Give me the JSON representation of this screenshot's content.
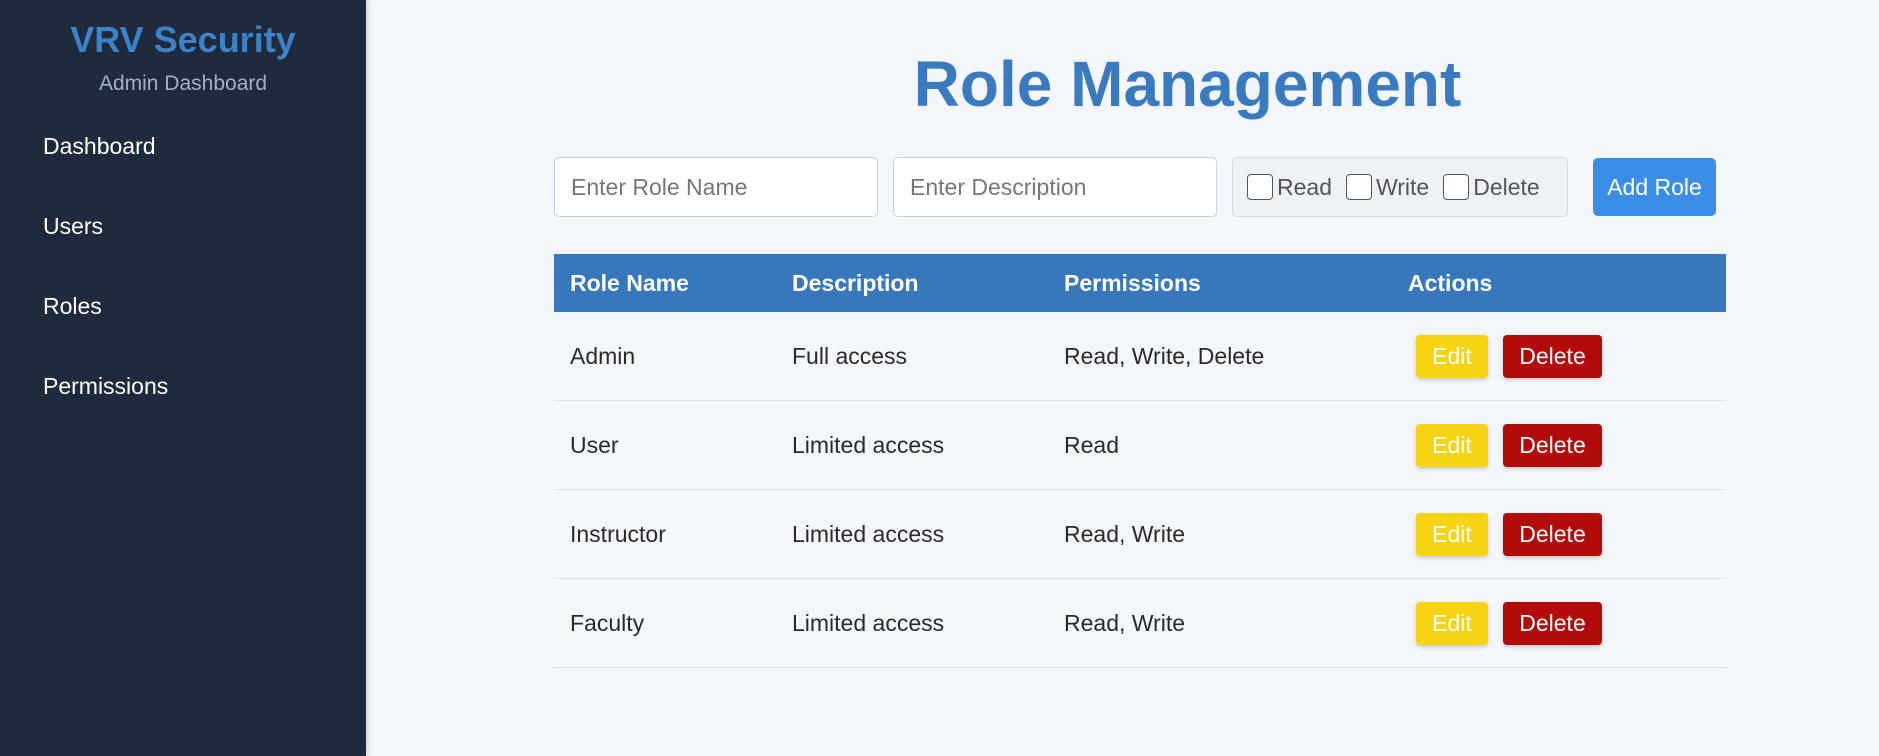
{
  "sidebar": {
    "brand_title": "VRV Security",
    "brand_subtitle": "Admin Dashboard",
    "items": [
      {
        "label": "Dashboard"
      },
      {
        "label": "Users"
      },
      {
        "label": "Roles"
      },
      {
        "label": "Permissions"
      }
    ]
  },
  "main": {
    "title": "Role Management",
    "form": {
      "role_name_placeholder": "Enter Role Name",
      "description_placeholder": "Enter Description",
      "permissions": [
        {
          "label": "Read",
          "checked": false
        },
        {
          "label": "Write",
          "checked": false
        },
        {
          "label": "Delete",
          "checked": false
        }
      ],
      "add_button": "Add Role"
    },
    "table": {
      "columns": [
        "Role Name",
        "Description",
        "Permissions",
        "Actions"
      ],
      "rows": [
        {
          "name": "Admin",
          "description": "Full access",
          "permissions": "Read, Write, Delete"
        },
        {
          "name": "User",
          "description": "Limited access",
          "permissions": "Read"
        },
        {
          "name": "Instructor",
          "description": "Limited access",
          "permissions": "Read, Write"
        },
        {
          "name": "Faculty",
          "description": "Limited access",
          "permissions": "Read, Write"
        }
      ],
      "edit_label": "Edit",
      "delete_label": "Delete"
    }
  },
  "colors": {
    "sidebar_bg": "#1f2a3c",
    "accent": "#3778bd",
    "add_button": "#3a8ee6",
    "edit_button": "#f7d40f",
    "delete_button": "#b30a0a"
  }
}
